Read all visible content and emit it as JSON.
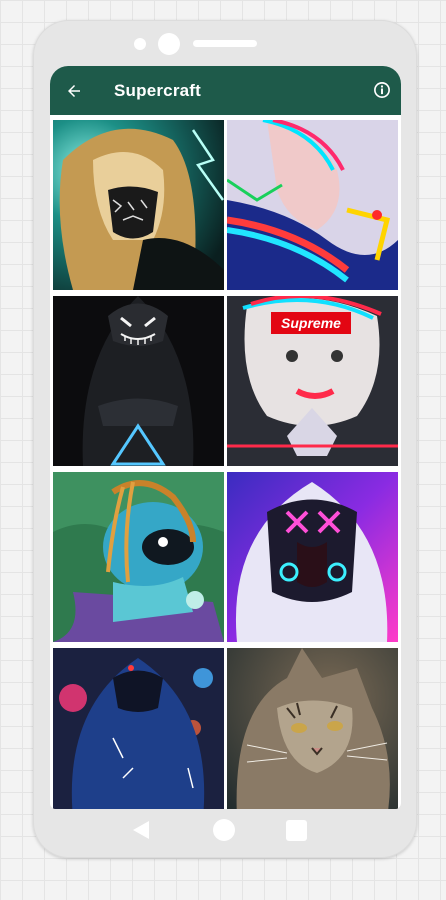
{
  "appbar": {
    "title": "Supercraft",
    "color": "#1e5a4a",
    "back_icon": "arrow-left-icon",
    "info_icon": "info-circle-icon"
  },
  "wallpapers": [
    {
      "subject": "blonde woman with bandana mask, neon"
    },
    {
      "subject": "glitch portrait woman"
    },
    {
      "subject": "hooded figure with LED mask and neon triangle"
    },
    {
      "subject": "glitch Marilyn portrait",
      "label": "Supreme"
    },
    {
      "subject": "cartoon astronaut with dreadlocks"
    },
    {
      "subject": "hooded figure with neon X mask"
    },
    {
      "subject": "hooded man in neon city"
    },
    {
      "subject": "cat close-up"
    }
  ],
  "navbar": {
    "back_icon": "nav-back-triangle-icon",
    "home_icon": "nav-home-circle-icon",
    "recents_icon": "nav-recents-square-icon",
    "color": "#ffffff"
  }
}
